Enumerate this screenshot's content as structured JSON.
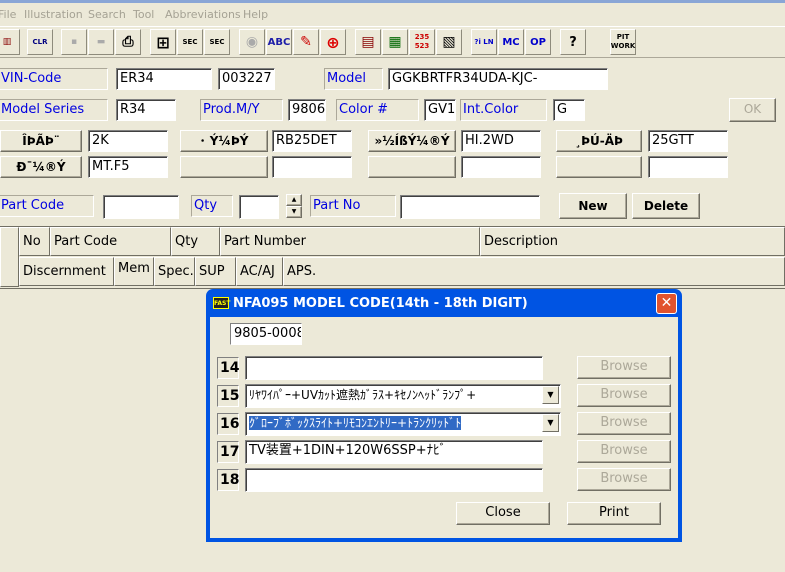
{
  "menu": [
    "File",
    "Illustration",
    "Search",
    "Tool",
    "Abbreviations",
    "Help"
  ],
  "toolbar": [
    {
      "icon": "illustration-book-icon",
      "text": "▥"
    },
    {
      "icon": "clear-eraser-icon",
      "text": "CLR"
    },
    {
      "icon": "save-disk-icon",
      "text": "▪"
    },
    {
      "icon": "folder-icon",
      "text": "▬"
    },
    {
      "icon": "printer-icon",
      "text": "⎙"
    },
    {
      "icon": "grid-layout-icon",
      "text": "⊞"
    },
    {
      "icon": "section-icon",
      "text": "SEC"
    },
    {
      "icon": "section-stack-icon",
      "text": "SEC"
    },
    {
      "icon": "disc-icon",
      "text": "◉"
    },
    {
      "icon": "abc-spell-icon",
      "text": "ABC"
    },
    {
      "icon": "car-edit-icon",
      "text": "✎"
    },
    {
      "icon": "add-circle-icon",
      "text": "⊕"
    },
    {
      "icon": "book-open-icon",
      "text": "▤"
    },
    {
      "icon": "clipboard-icon",
      "text": "▦"
    },
    {
      "icon": "number-convert-icon",
      "text": "235 523"
    },
    {
      "icon": "document-icon",
      "text": "▧"
    },
    {
      "icon": "info-ln-icon",
      "text": "?i LN"
    },
    {
      "icon": "mc-icon",
      "text": "MC"
    },
    {
      "icon": "op-icon",
      "text": "OP"
    },
    {
      "icon": "help-bubble-icon",
      "text": "?"
    },
    {
      "icon": "pit-work-icon",
      "text": "PIT WORK"
    }
  ],
  "form": {
    "vin_label": "VIN-Code",
    "vin_prefix": "ER34",
    "vin_serial": "003227",
    "model_label": "Model",
    "model_value": "GGKBRTFR34UDA-KJC-",
    "series_label": "Model Series",
    "series_value": "R34",
    "prod_label": "Prod.M/Y",
    "prod_value": "9806",
    "color_label": "Color #",
    "color_value": "GV1",
    "int_color_label": "Int.Color",
    "int_color_value": "G",
    "ok_label": "OK",
    "spec_buttons": [
      "ÎÞÃÞ¨",
      "･ Ý¼ÞÝ",
      "»½ÍßÝ¼®Ý",
      "¸ÞÚ-ÄÞ",
      "Ð¯¼®Ý",
      "",
      "",
      ""
    ],
    "spec_values": [
      "2K",
      "RB25DET",
      "HI.2WD",
      "25GTT",
      "MT.F5",
      "",
      "",
      ""
    ],
    "part_code_label": "Part Code",
    "part_code_value": "",
    "qty_label": "Qty",
    "qty_value": "",
    "part_no_label": "Part No",
    "part_no_value": "",
    "new_label": "New",
    "delete_label": "Delete"
  },
  "grid": {
    "row1": [
      "No",
      "Part Code",
      "Qty",
      "Part Number",
      "Description"
    ],
    "row2": [
      "Discernment",
      "Mem",
      "Spec.",
      "SUP",
      "AC/AJ",
      "APS."
    ]
  },
  "dialog": {
    "icon_text": "FAST",
    "title": "NFA095 MODEL CODE(14th - 18th DIGIT)",
    "code": "9805-0008",
    "rows": [
      {
        "num": "14",
        "value": "",
        "dropdown": false,
        "selected": false
      },
      {
        "num": "15",
        "value": "ﾘﾔﾜｲﾊﾟｰ+UVｶｯﾄ遮熱ｶﾞﾗｽ+ｷｾﾉﾝﾍｯﾄﾞﾗﾝﾌﾟ+",
        "dropdown": true,
        "selected": false
      },
      {
        "num": "16",
        "value": "ｸﾞﾛｰﾌﾞﾎﾞｯｸｽﾗｲﾄ+ﾘﾓｺﾝｴﾝﾄﾘｰ+ﾄﾗﾝｸﾘｯﾄﾞﾄ",
        "dropdown": true,
        "selected": true
      },
      {
        "num": "17",
        "value": "TV装置+1DIN+120W6SSP+ﾅﾋﾞ",
        "dropdown": false,
        "selected": false
      },
      {
        "num": "18",
        "value": "",
        "dropdown": false,
        "selected": false
      }
    ],
    "browse_label": "Browse",
    "close_label": "Close",
    "print_label": "Print"
  }
}
